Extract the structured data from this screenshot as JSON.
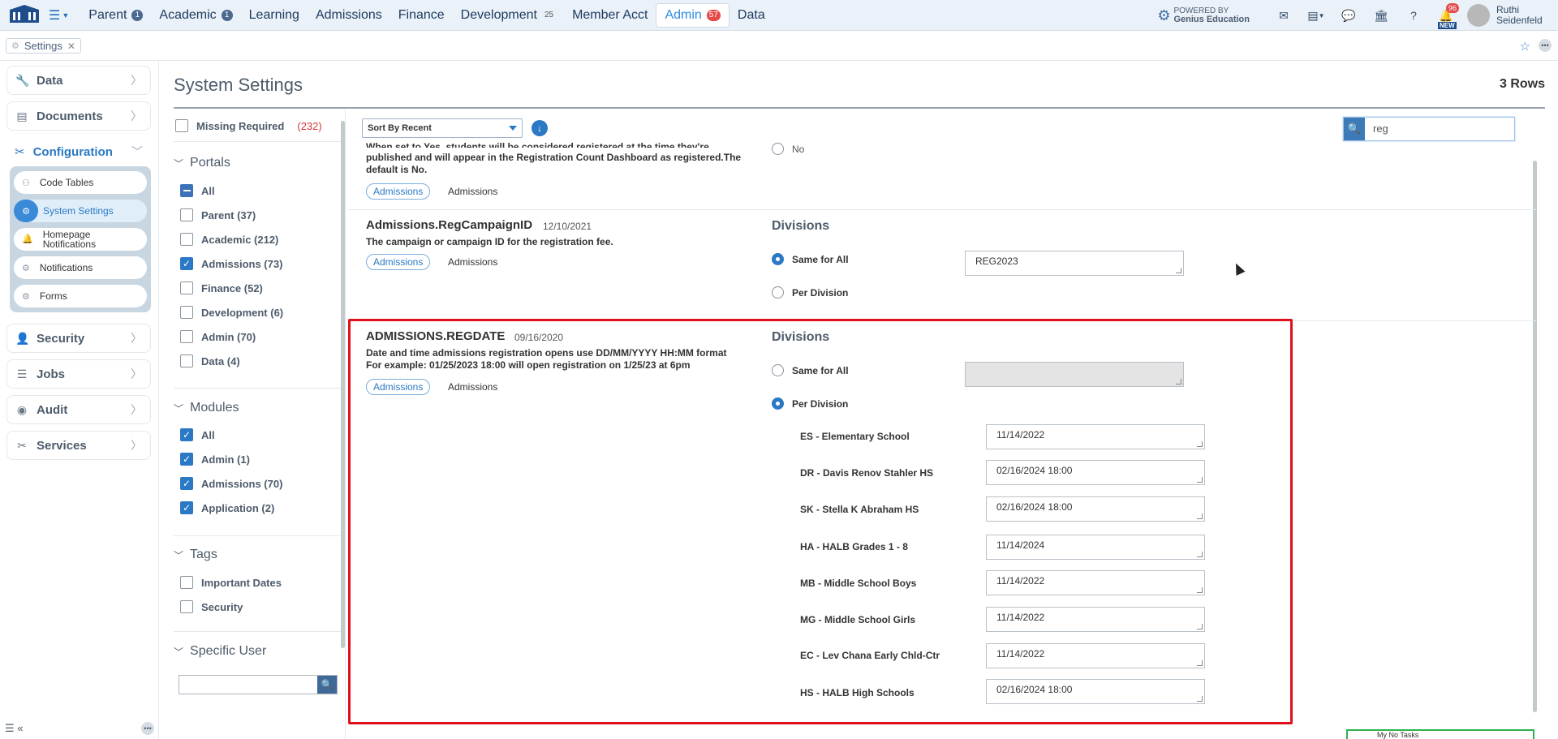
{
  "nav": {
    "items": [
      {
        "label": "Parent",
        "badge": "1"
      },
      {
        "label": "Academic",
        "badge": "1"
      },
      {
        "label": "Learning",
        "badge": ""
      },
      {
        "label": "Admissions",
        "badge": ""
      },
      {
        "label": "Finance",
        "badge": ""
      },
      {
        "label": "Development",
        "badge": "25"
      },
      {
        "label": "Member Acct",
        "badge": ""
      },
      {
        "label": "Admin",
        "badge": "57"
      },
      {
        "label": "Data",
        "badge": ""
      }
    ],
    "powered_line1": "POWERED BY",
    "powered_line2": "Genius Education",
    "bell_count": "96",
    "new_tag": "NEW",
    "user_first": "Ruthi",
    "user_last": "Seidenfeld"
  },
  "breadcrumb": {
    "tab": "Settings",
    "close": "✕"
  },
  "sidebar": {
    "data": "Data",
    "documents": "Documents",
    "configuration": "Configuration",
    "sub": [
      "Code Tables",
      "System Settings",
      "Homepage Notifications",
      "Notifications",
      "Forms"
    ],
    "security": "Security",
    "jobs": "Jobs",
    "audit": "Audit",
    "services": "Services"
  },
  "page": {
    "title": "System Settings",
    "row_count": "3 Rows"
  },
  "filters": {
    "missing_required": "Missing Required",
    "missing_count": "(232)",
    "portals_title": "Portals",
    "portals": [
      "All",
      "Parent (37)",
      "Academic (212)",
      "Admissions (73)",
      "Finance (52)",
      "Development (6)",
      "Admin (70)",
      "Data (4)"
    ],
    "modules_title": "Modules",
    "modules": [
      "All",
      "Admin (1)",
      "Admissions (70)",
      "Application (2)"
    ],
    "tags_title": "Tags",
    "tags": [
      "Important Dates",
      "Security"
    ],
    "specific_user_title": "Specific User"
  },
  "toolbar": {
    "sort": "Sort By Recent",
    "search_value": "reg"
  },
  "records": {
    "r0": {
      "desc_line1": "When set to Yes, students will be considered registered at the time they're",
      "desc_line2": "published and will appear in the Registration Count Dashboard as registered.The",
      "desc_line3": "default is No.",
      "tag_pill": "Admissions",
      "tag_plain": "Admissions",
      "radio_no": "No"
    },
    "r1": {
      "name": "Admissions.RegCampaignID",
      "date": "12/10/2021",
      "desc": "The campaign or campaign ID for the registration fee.",
      "tag_pill": "Admissions",
      "tag_plain": "Admissions",
      "divisions": "Divisions",
      "same_for_all": "Same for All",
      "per_division": "Per Division",
      "value": "REG2023"
    },
    "r2": {
      "name": "ADMISSIONS.REGDATE",
      "date": "09/16/2020",
      "desc_line1": "Date and time admissions registration opens use DD/MM/YYYY HH:MM format",
      "desc_line2": "For example: 01/25/2023 18:00 will open registration on 1/25/23 at 6pm",
      "tag_pill": "Admissions",
      "tag_plain": "Admissions",
      "divisions": "Divisions",
      "same_for_all": "Same for All",
      "per_division": "Per Division",
      "division_rows": [
        {
          "label": "ES - Elementary School",
          "value": "11/14/2022"
        },
        {
          "label": "DR - Davis Renov Stahler HS",
          "value": "02/16/2024 18:00"
        },
        {
          "label": "SK - Stella K Abraham HS",
          "value": "02/16/2024 18:00"
        },
        {
          "label": "HA - HALB Grades 1 - 8",
          "value": "11/14/2024"
        },
        {
          "label": "MB - Middle School Boys",
          "value": "11/14/2022"
        },
        {
          "label": "MG - Middle School Girls",
          "value": "11/14/2022"
        },
        {
          "label": "EC - Lev Chana Early Chld-Ctr",
          "value": "11/14/2022"
        },
        {
          "label": "HS - HALB High Schools",
          "value": "02/16/2024 18:00"
        }
      ]
    }
  },
  "todo": "My No Tasks"
}
